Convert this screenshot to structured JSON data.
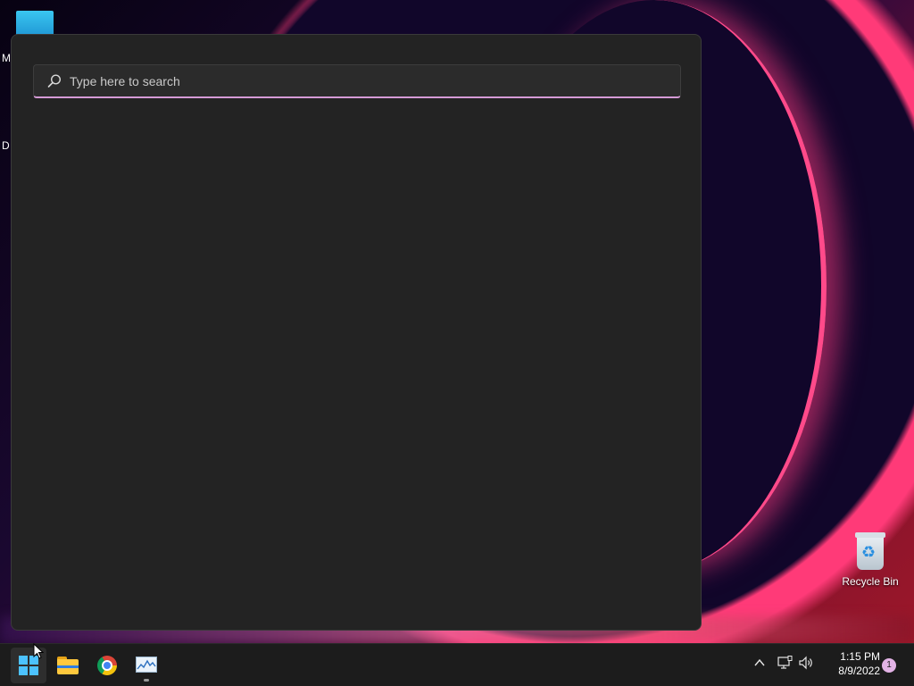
{
  "desktop": {
    "partial_labels": [
      "M",
      "D"
    ],
    "recycle_bin": {
      "label": "Recycle Bin",
      "icon": "recycle-bin-icon"
    }
  },
  "search": {
    "placeholder": "Type here to search",
    "value": "",
    "icon": "search-icon",
    "accent_color": "#d59ad6"
  },
  "taskbar": {
    "apps": [
      {
        "name": "Start",
        "icon": "windows-logo-icon",
        "active": true
      },
      {
        "name": "File Explorer",
        "icon": "folder-icon",
        "active": false
      },
      {
        "name": "Google Chrome",
        "icon": "chrome-icon",
        "active": false
      },
      {
        "name": "Performance Monitor",
        "icon": "performance-monitor-icon",
        "active": false,
        "running": true
      }
    ],
    "tray": {
      "chevron_icon": "chevron-up-icon",
      "network_icon": "network-icon",
      "volume_icon": "volume-icon"
    },
    "clock": {
      "time": "1:15 PM",
      "date": "8/9/2022"
    },
    "notification_count": "1"
  },
  "colors": {
    "panel_bg": "#232323",
    "taskbar_bg": "#1c1c1c",
    "accent_blue": "#4cc2ff"
  }
}
